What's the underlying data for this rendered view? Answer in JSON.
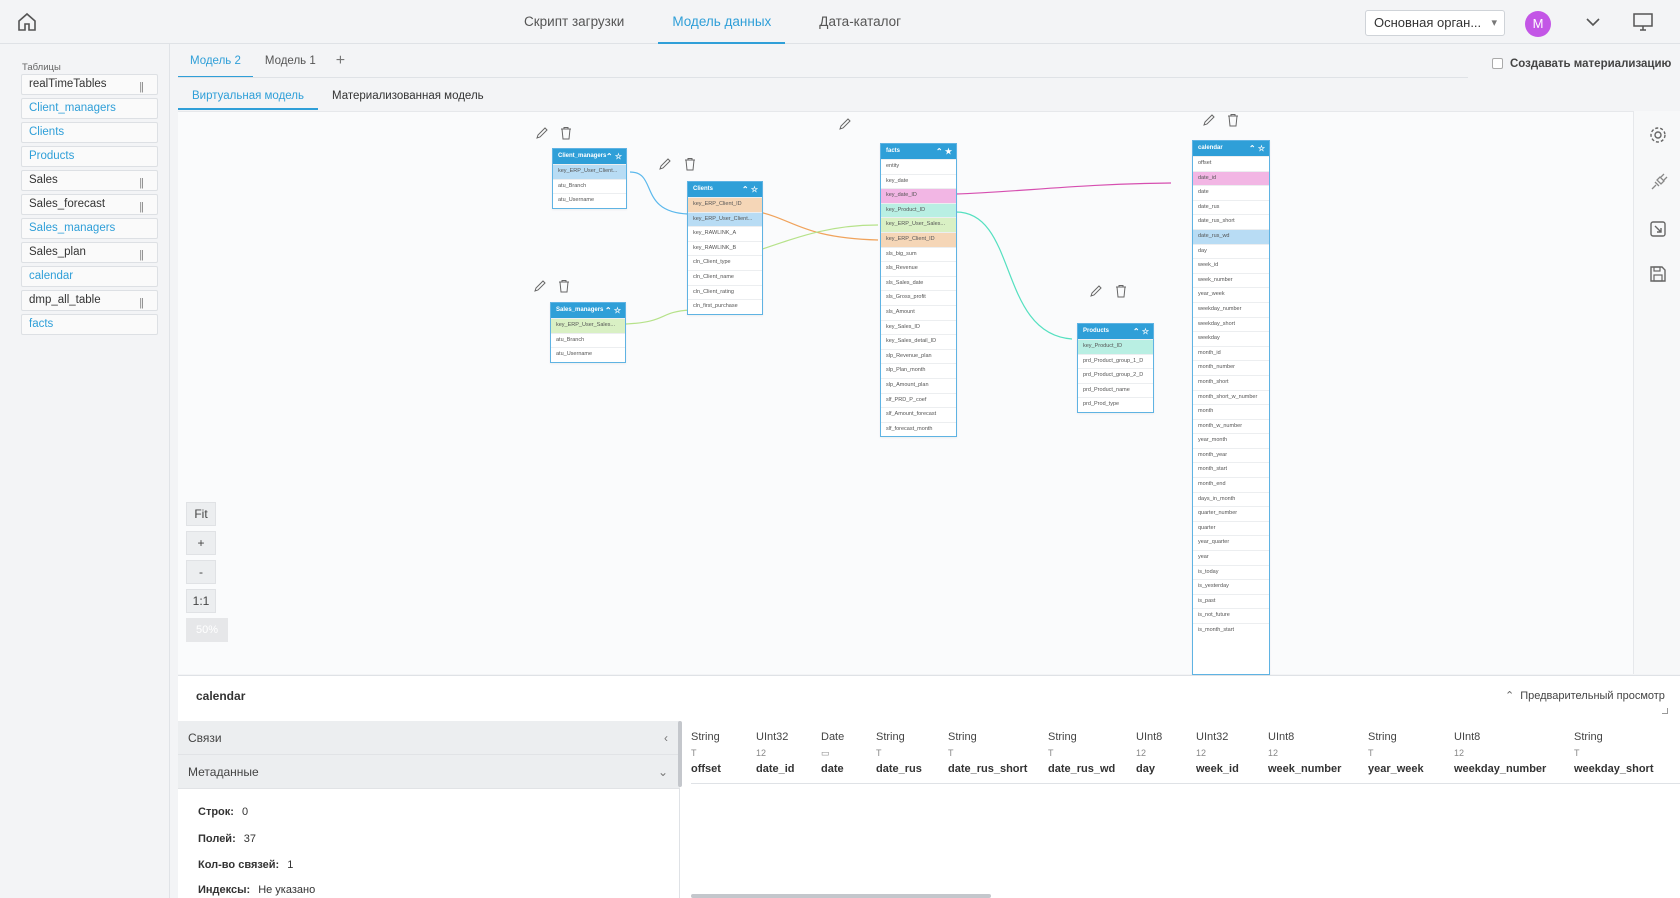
{
  "nav": {
    "items": [
      {
        "label": "Скрипт загрузки"
      },
      {
        "label": "Модель данных"
      },
      {
        "label": "Дата-каталог"
      }
    ]
  },
  "org": {
    "label": "Основная орган..."
  },
  "user": {
    "initial": "M",
    "avatar_color": "#c356e6"
  },
  "sidebar": {
    "title": "Таблицы",
    "items": [
      {
        "label": "realTimeTables"
      },
      {
        "label": "Client_managers"
      },
      {
        "label": "Clients"
      },
      {
        "label": "Products"
      },
      {
        "label": "Sales"
      },
      {
        "label": "Sales_forecast"
      },
      {
        "label": "Sales_managers"
      },
      {
        "label": "Sales_plan"
      },
      {
        "label": "calendar"
      },
      {
        "label": "dmp_all_table"
      },
      {
        "label": "facts"
      }
    ]
  },
  "model_tabs": [
    {
      "label": "Модель 2"
    },
    {
      "label": "Модель 1"
    }
  ],
  "add_tab": "+",
  "materialization": {
    "label": "Создавать материализацию",
    "checked": false
  },
  "view_tabs": [
    {
      "label": "Виртуальная модель"
    },
    {
      "label": "Материализованная модель"
    }
  ],
  "zoom": {
    "fit": "Fit",
    "plus": "+",
    "minus": "-",
    "one": "1:1",
    "level": "50%"
  },
  "tables": {
    "client_managers": {
      "name": "Client_managers",
      "rows": [
        "key_ERP_User_Client...",
        "atu_Branch",
        "atu_Username"
      ]
    },
    "clients": {
      "name": "Clients",
      "rows": [
        "key_ERP_Client_ID",
        "key_ERP_User_Client...",
        "key_RAWLINK_A",
        "key_RAWLINK_B",
        "cln_Client_type",
        "cln_Client_name",
        "cln_Client_rating",
        "cln_first_purchase"
      ]
    },
    "sales_managers": {
      "name": "Sales_managers",
      "rows": [
        "key_ERP_User_Sales...",
        "atu_Branch",
        "atu_Username"
      ]
    },
    "facts": {
      "name": "facts",
      "rows": [
        "entity",
        "key_date",
        "key_date_ID",
        "key_Product_ID",
        "key_ERP_User_Sales...",
        "key_ERP_Client_ID",
        "sls_big_sum",
        "sls_Revenue",
        "sls_Sales_date",
        "sls_Gross_profit",
        "sls_Amount",
        "key_Sales_ID",
        "key_Sales_detail_ID",
        "slp_Revenue_plan",
        "slp_Plan_month",
        "slp_Amount_plan",
        "slf_PRD_P_coef",
        "slf_Amount_forecast",
        "slf_forecast_month"
      ]
    },
    "products": {
      "name": "Products",
      "rows": [
        "key_Product_ID",
        "prd_Product_group_1_D",
        "prd_Product_group_2_D",
        "prd_Product_name",
        "prd_Prod_type"
      ]
    },
    "calendar": {
      "name": "calendar",
      "rows": [
        "offset",
        "date_id",
        "date",
        "date_rus",
        "date_rus_short",
        "date_rus_wd",
        "day",
        "week_id",
        "week_number",
        "year_week",
        "weekday_number",
        "weekday_short",
        "weekday",
        "month_id",
        "month_number",
        "month_short",
        "month_short_w_number",
        "month",
        "month_w_number",
        "year_month",
        "month_year",
        "month_start",
        "month_end",
        "days_in_month",
        "quarter_number",
        "quarter",
        "year_quarter",
        "year",
        "is_today",
        "is_yesterday",
        "is_past",
        "is_not_future",
        "is_month_start"
      ]
    }
  },
  "bottom": {
    "title": "calendar",
    "preview": "Предварительный просмотр",
    "sections": [
      {
        "label": "Связи"
      },
      {
        "label": "Метаданные"
      }
    ],
    "meta": [
      {
        "key": "Строк:",
        "value": "0"
      },
      {
        "key": "Полей:",
        "value": "37"
      },
      {
        "key": "Кол-во связей:",
        "value": "1"
      },
      {
        "key": "Индексы:",
        "value": "Не указано"
      }
    ],
    "columns": [
      {
        "type": "String",
        "icon": "T",
        "name": "offset"
      },
      {
        "type": "UInt32",
        "icon": "12",
        "name": "date_id"
      },
      {
        "type": "Date",
        "icon": "calendar-glyph",
        "name": "date"
      },
      {
        "type": "String",
        "icon": "T",
        "name": "date_rus"
      },
      {
        "type": "String",
        "icon": "T",
        "name": "date_rus_short"
      },
      {
        "type": "String",
        "icon": "T",
        "name": "date_rus_wd"
      },
      {
        "type": "UInt8",
        "icon": "12",
        "name": "day"
      },
      {
        "type": "UInt32",
        "icon": "12",
        "name": "week_id"
      },
      {
        "type": "UInt8",
        "icon": "12",
        "name": "week_number"
      },
      {
        "type": "String",
        "icon": "T",
        "name": "year_week"
      },
      {
        "type": "UInt8",
        "icon": "12",
        "name": "weekday_number"
      },
      {
        "type": "String",
        "icon": "T",
        "name": "weekday_short"
      }
    ]
  },
  "colors": {
    "accent": "#2f9fd8",
    "link_blue": "#5bb8ec",
    "link_orange": "#f0a35c",
    "link_green": "#b6e28a",
    "link_pink": "#d64fb0",
    "link_teal": "#55e0c0"
  }
}
